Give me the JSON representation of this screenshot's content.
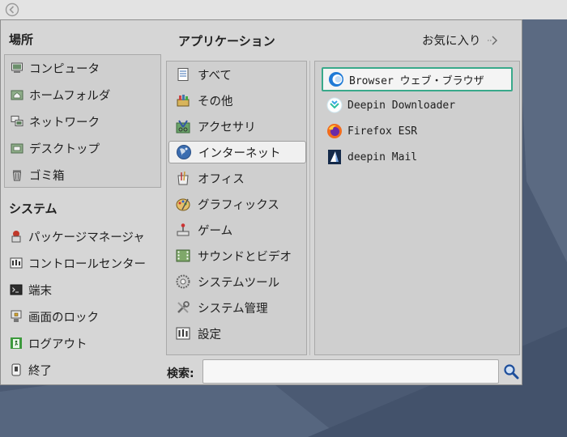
{
  "places": {
    "title": "場所",
    "items": [
      {
        "label": "コンピュータ",
        "icon": "computer-icon"
      },
      {
        "label": "ホームフォルダ",
        "icon": "home-folder-icon"
      },
      {
        "label": "ネットワーク",
        "icon": "network-icon"
      },
      {
        "label": "デスクトップ",
        "icon": "desktop-folder-icon"
      },
      {
        "label": "ゴミ箱",
        "icon": "trash-icon"
      }
    ]
  },
  "system": {
    "title": "システム",
    "items": [
      {
        "label": "パッケージマネージャ",
        "icon": "package-manager-icon"
      },
      {
        "label": "コントロールセンター",
        "icon": "control-center-icon"
      },
      {
        "label": "端末",
        "icon": "terminal-icon"
      },
      {
        "label": "画面のロック",
        "icon": "lock-screen-icon"
      },
      {
        "label": "ログアウト",
        "icon": "logout-icon"
      },
      {
        "label": "終了",
        "icon": "shutdown-icon"
      }
    ]
  },
  "applications": {
    "title": "アプリケーション",
    "favorites_label": "お気に入り",
    "categories": [
      {
        "label": "すべて",
        "icon": "all-apps-icon"
      },
      {
        "label": "その他",
        "icon": "other-apps-icon"
      },
      {
        "label": "アクセサリ",
        "icon": "accessories-icon"
      },
      {
        "label": "インターネット",
        "icon": "internet-globe-icon",
        "selected": true
      },
      {
        "label": "オフィス",
        "icon": "office-icon"
      },
      {
        "label": "グラフィックス",
        "icon": "graphics-icon"
      },
      {
        "label": "ゲーム",
        "icon": "games-icon"
      },
      {
        "label": "サウンドとビデオ",
        "icon": "sound-video-icon"
      },
      {
        "label": "システムツール",
        "icon": "system-tools-icon"
      },
      {
        "label": "システム管理",
        "icon": "system-admin-icon"
      },
      {
        "label": "設定",
        "icon": "settings-icon"
      }
    ],
    "apps": [
      {
        "label": "Browser ウェブ・ブラウザ",
        "icon": "browser-icon",
        "focused": true
      },
      {
        "label": "Deepin Downloader",
        "icon": "downloader-icon"
      },
      {
        "label": "Firefox ESR",
        "icon": "firefox-icon"
      },
      {
        "label": "deepin Mail",
        "icon": "mail-icon"
      }
    ]
  },
  "search": {
    "label": "検索:",
    "value": "",
    "placeholder": ""
  },
  "colors": {
    "menu_bg": "#d6d6d6",
    "panel_bg": "#cfcfcf",
    "focus_ring": "#39a98a",
    "wallpaper": "#4a5a74"
  }
}
